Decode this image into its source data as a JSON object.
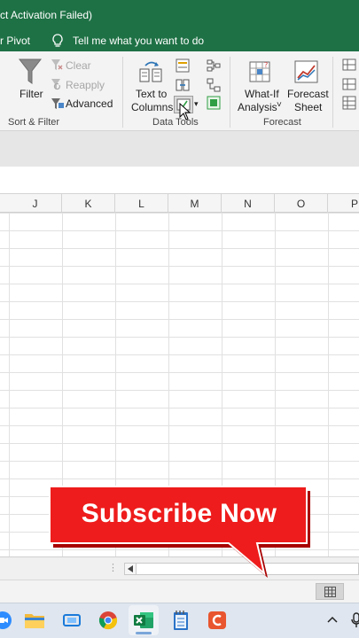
{
  "window": {
    "title": "ct Activation Failed)"
  },
  "tellbar": {
    "pivot_text": "r Pivot",
    "tell_me": "Tell me what you want to do"
  },
  "ribbon": {
    "sort_filter": {
      "filter": "Filter",
      "clear": "Clear",
      "reapply": "Reapply",
      "advanced": "Advanced",
      "group_label": "Sort & Filter"
    },
    "data_tools": {
      "text_to_line1": "Text to",
      "text_to_line2": "Columns",
      "group_label": "Data Tools"
    },
    "forecast": {
      "whatif_line1": "What-If",
      "whatif_line2": "Analysis",
      "whatif_arrow": "˅",
      "sheet_line1": "Forecast",
      "sheet_line2": "Sheet",
      "group_label": "Forecast"
    }
  },
  "columns": [
    "J",
    "K",
    "L",
    "M",
    "N",
    "O",
    "P"
  ],
  "overlay": {
    "subscribe_text": "Subscribe Now"
  },
  "colors": {
    "excel_green": "#1e7145",
    "subscribe_red": "#ee1c1c",
    "ribbon_bg": "#f3f3f3"
  }
}
